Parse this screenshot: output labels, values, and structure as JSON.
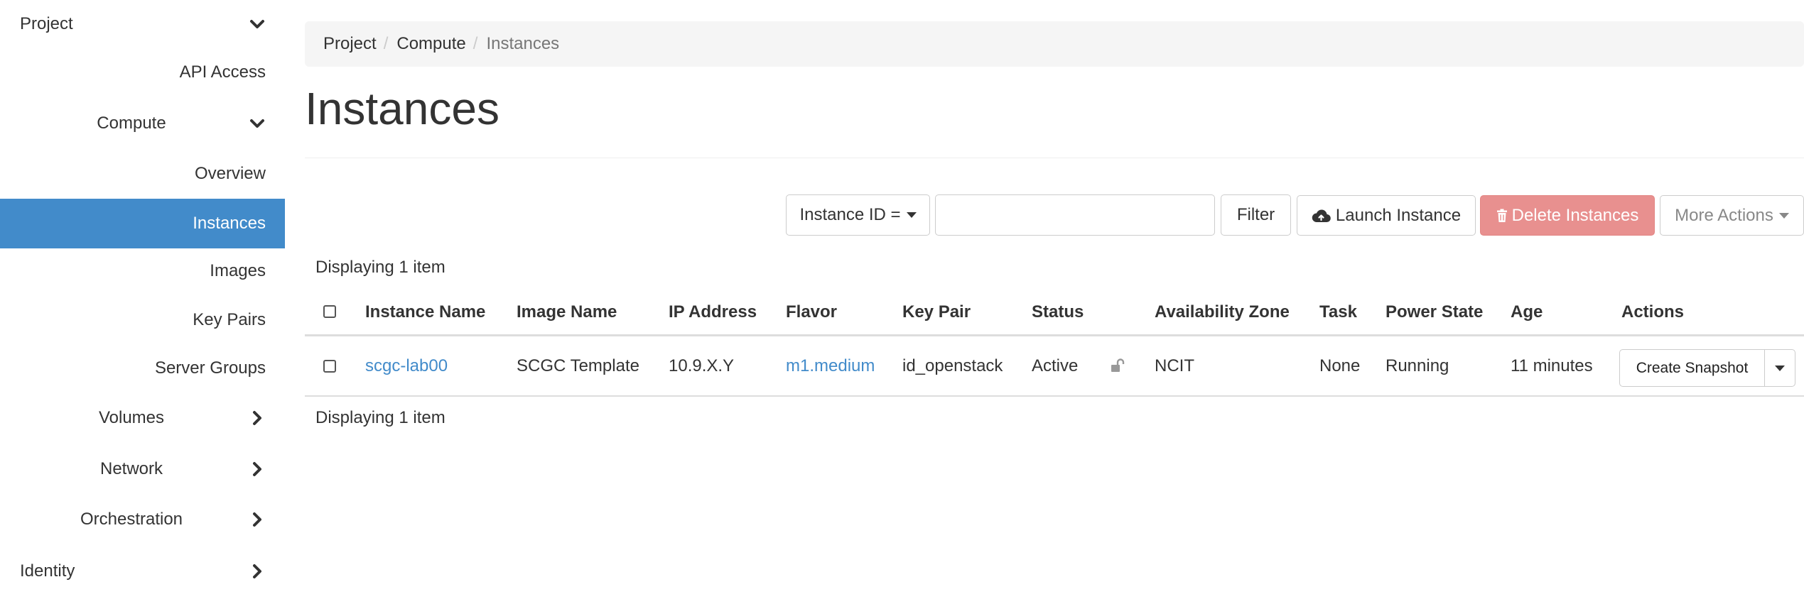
{
  "sidebar": {
    "project": "Project",
    "api_access": "API Access",
    "compute": "Compute",
    "overview": "Overview",
    "instances": "Instances",
    "images": "Images",
    "key_pairs": "Key Pairs",
    "server_groups": "Server Groups",
    "volumes": "Volumes",
    "network": "Network",
    "orchestration": "Orchestration",
    "identity": "Identity"
  },
  "breadcrumb": {
    "items": [
      "Project",
      "Compute",
      "Instances"
    ],
    "separator": "/"
  },
  "page": {
    "title": "Instances"
  },
  "toolbar": {
    "filter_field": "Instance ID =",
    "filter_value": "",
    "filter_button": "Filter",
    "launch_button": "Launch Instance",
    "delete_button": "Delete Instances",
    "more_actions": "More Actions"
  },
  "table": {
    "displaying_top": "Displaying 1 item",
    "displaying_bottom": "Displaying 1 item",
    "headers": [
      "Instance Name",
      "Image Name",
      "IP Address",
      "Flavor",
      "Key Pair",
      "Status",
      "Availability Zone",
      "Task",
      "Power State",
      "Age",
      "Actions"
    ],
    "rows": [
      {
        "instance_name": "scgc-lab00",
        "image_name": "SCGC Template",
        "ip_address": "10.9.X.Y",
        "flavor": "m1.medium",
        "key_pair": "id_openstack",
        "status": "Active",
        "availability_zone": "NCIT",
        "task": "None",
        "power_state": "Running",
        "age": "11 minutes",
        "action": "Create Snapshot"
      }
    ]
  },
  "colors": {
    "active_nav": "#428bca",
    "link": "#428bca",
    "danger_button": "#e8908f",
    "breadcrumb_bg": "#f5f5f5"
  },
  "icons": {
    "expanded": "chevron-down-icon",
    "collapsed": "chevron-right-icon",
    "launch": "cloud-upload-icon",
    "delete": "trash-icon",
    "lock": "unlock-icon"
  }
}
